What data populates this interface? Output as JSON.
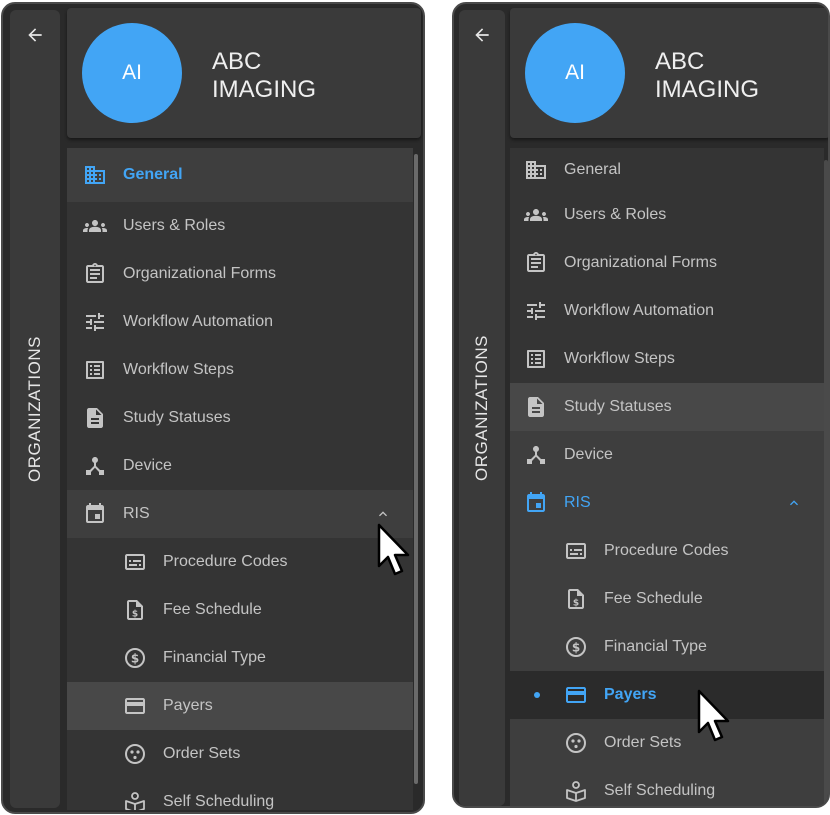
{
  "colors": {
    "accent": "#42a5f5",
    "text": "#c4c4c4",
    "panel": "#2a2a2a"
  },
  "left": {
    "back_icon": "arrow-left-icon",
    "rail_label": "ORGANIZATIONS",
    "avatar": "AI",
    "org_line1": "ABC",
    "org_line2": "IMAGING",
    "menu": [
      {
        "label": "General",
        "icon": "building-icon"
      },
      {
        "label": "Users & Roles",
        "icon": "users-icon"
      },
      {
        "label": "Organizational Forms",
        "icon": "clipboard-icon"
      },
      {
        "label": "Workflow Automation",
        "icon": "tune-icon"
      },
      {
        "label": "Workflow Steps",
        "icon": "list-icon"
      },
      {
        "label": "Study Statuses",
        "icon": "document-icon"
      },
      {
        "label": "Device",
        "icon": "device-hub-icon"
      },
      {
        "label": "RIS",
        "icon": "calendar-icon"
      }
    ],
    "submenu": [
      {
        "label": "Procedure Codes",
        "icon": "code-card-icon"
      },
      {
        "label": "Fee Schedule",
        "icon": "fee-document-icon"
      },
      {
        "label": "Financial Type",
        "icon": "dollar-circle-icon"
      },
      {
        "label": "Payers",
        "icon": "credit-card-icon"
      },
      {
        "label": "Order Sets",
        "icon": "order-sets-icon"
      },
      {
        "label": "Self Scheduling",
        "icon": "self-scheduling-icon"
      }
    ]
  },
  "right": {
    "back_icon": "arrow-left-icon",
    "rail_label": "ORGANIZATIONS",
    "avatar": "AI",
    "org_line1": "ABC",
    "org_line2": "IMAGING",
    "menu": [
      {
        "label": "General",
        "icon": "building-icon"
      },
      {
        "label": "Users & Roles",
        "icon": "users-icon"
      },
      {
        "label": "Organizational Forms",
        "icon": "clipboard-icon"
      },
      {
        "label": "Workflow Automation",
        "icon": "tune-icon"
      },
      {
        "label": "Workflow Steps",
        "icon": "list-icon"
      },
      {
        "label": "Study Statuses",
        "icon": "document-icon"
      },
      {
        "label": "Device",
        "icon": "device-hub-icon"
      },
      {
        "label": "RIS",
        "icon": "calendar-icon"
      }
    ],
    "submenu": [
      {
        "label": "Procedure Codes",
        "icon": "code-card-icon"
      },
      {
        "label": "Fee Schedule",
        "icon": "fee-document-icon"
      },
      {
        "label": "Financial Type",
        "icon": "dollar-circle-icon"
      },
      {
        "label": "Payers",
        "icon": "credit-card-icon"
      },
      {
        "label": "Order Sets",
        "icon": "order-sets-icon"
      },
      {
        "label": "Self Scheduling",
        "icon": "self-scheduling-icon"
      }
    ]
  }
}
